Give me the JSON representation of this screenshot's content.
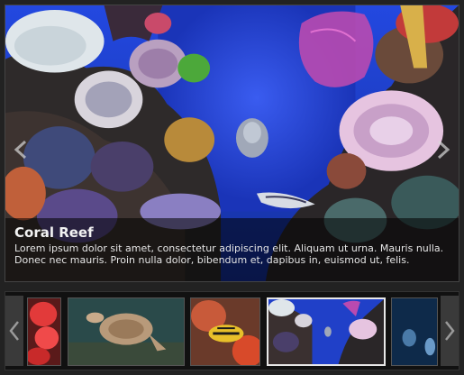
{
  "slide": {
    "title": "Coral Reef",
    "description": "Lorem ipsum dolor sit amet, consectetur adipiscing elit. Aliquam ut urna. Mauris nulla. Donec nec mauris. Proin nulla dolor, bibendum et, dapibus in, euismod ut, felis."
  },
  "navigation": {
    "prev_icon": "chevron-left-icon",
    "next_icon": "chevron-right-icon"
  },
  "thumbnails": [
    {
      "subject": "red coral"
    },
    {
      "subject": "sea turtle"
    },
    {
      "subject": "yellow striped fish"
    },
    {
      "subject": "coral reef"
    },
    {
      "subject": "blue fish"
    }
  ],
  "active_thumbnail": 4,
  "colors": {
    "water": "#1d3fd8",
    "caption_overlay": "#000000",
    "frame": "#222222"
  }
}
